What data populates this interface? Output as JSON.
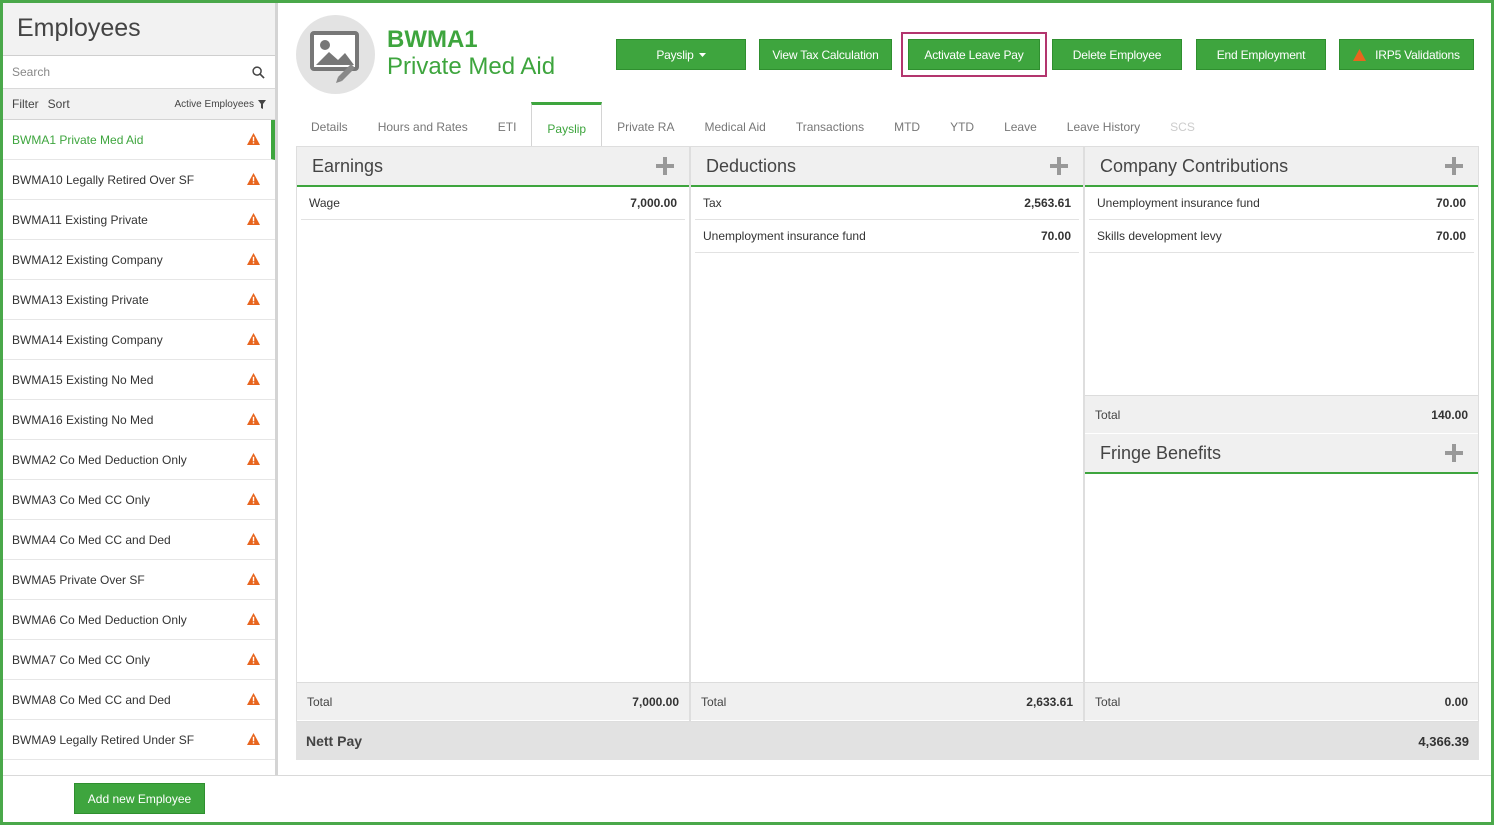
{
  "sidebar": {
    "title": "Employees",
    "search_placeholder": "Search",
    "filter_label": "Filter",
    "sort_label": "Sort",
    "active_filter": "Active Employees",
    "employees": [
      "BWMA1 Private Med Aid",
      "BWMA10 Legally Retired Over SF",
      "BWMA11 Existing Private",
      "BWMA12 Existing Company",
      "BWMA13 Existing Private",
      "BWMA14 Existing Company",
      "BWMA15 Existing No Med",
      "BWMA16 Existing No Med",
      "BWMA2 Co Med Deduction Only",
      "BWMA3 Co Med CC Only",
      "BWMA4 Co Med CC and Ded",
      "BWMA5 Private Over SF",
      "BWMA6 Co Med Deduction Only",
      "BWMA7 Co Med CC Only",
      "BWMA8 Co Med CC and Ded",
      "BWMA9 Legally Retired Under SF"
    ],
    "add_button": "Add new Employee"
  },
  "employee": {
    "code": "BWMA1",
    "name": "Private Med Aid"
  },
  "actions": {
    "payslip": "Payslip",
    "view_tax": "View Tax Calculation",
    "activate_leave": "Activate Leave Pay",
    "delete": "Delete Employee",
    "end": "End Employment",
    "irp5": "IRP5 Validations"
  },
  "tabs": [
    "Details",
    "Hours and Rates",
    "ETI",
    "Payslip",
    "Private RA",
    "Medical Aid",
    "Transactions",
    "MTD",
    "YTD",
    "Leave",
    "Leave History",
    "SCS"
  ],
  "earnings": {
    "title": "Earnings",
    "rows": [
      {
        "label": "Wage",
        "amount": "7,000.00"
      }
    ],
    "total_label": "Total",
    "total": "7,000.00"
  },
  "deductions": {
    "title": "Deductions",
    "rows": [
      {
        "label": "Tax",
        "amount": "2,563.61"
      },
      {
        "label": "Unemployment insurance fund",
        "amount": "70.00"
      }
    ],
    "total_label": "Total",
    "total": "2,633.61"
  },
  "contributions": {
    "title": "Company Contributions",
    "rows": [
      {
        "label": "Unemployment insurance fund",
        "amount": "70.00"
      },
      {
        "label": "Skills development levy",
        "amount": "70.00"
      }
    ],
    "total_label": "Total",
    "total": "140.00"
  },
  "fringe": {
    "title": "Fringe Benefits",
    "total_label": "Total",
    "total": "0.00"
  },
  "nett": {
    "label": "Nett Pay",
    "amount": "4,366.39"
  },
  "colors": {
    "accent": "#3ea53e",
    "warning": "#e8651e",
    "highlight": "#b3356e"
  }
}
